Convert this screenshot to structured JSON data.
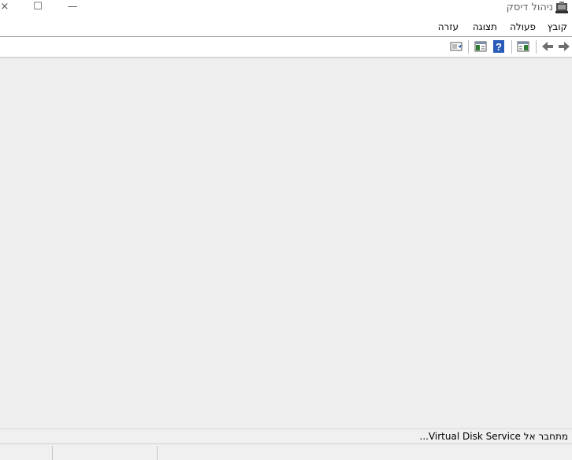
{
  "window": {
    "title": "ניהול דיסק",
    "icon": "disk-management-icon",
    "controls": {
      "close": "×",
      "maximize": "☐",
      "minimize": "—"
    }
  },
  "menu": {
    "items": [
      {
        "label": "קובץ"
      },
      {
        "label": "פעולה"
      },
      {
        "label": "תצוגה"
      },
      {
        "label": "עזרה"
      }
    ]
  },
  "toolbar": {
    "buttons": [
      {
        "icon": "forward-arrow-icon"
      },
      {
        "icon": "back-arrow-icon"
      },
      {
        "icon": "show-hide-console-tree-icon"
      },
      {
        "icon": "help-icon"
      },
      {
        "icon": "show-hide-action-pane-icon"
      },
      {
        "icon": "properties-icon"
      }
    ]
  },
  "status": {
    "text": "מתחבר אל Virtual Disk Service..."
  },
  "colors": {
    "content_bg": "#efefef",
    "help_blue": "#2a5bb8",
    "arrow_gray": "#6e6e6e"
  }
}
